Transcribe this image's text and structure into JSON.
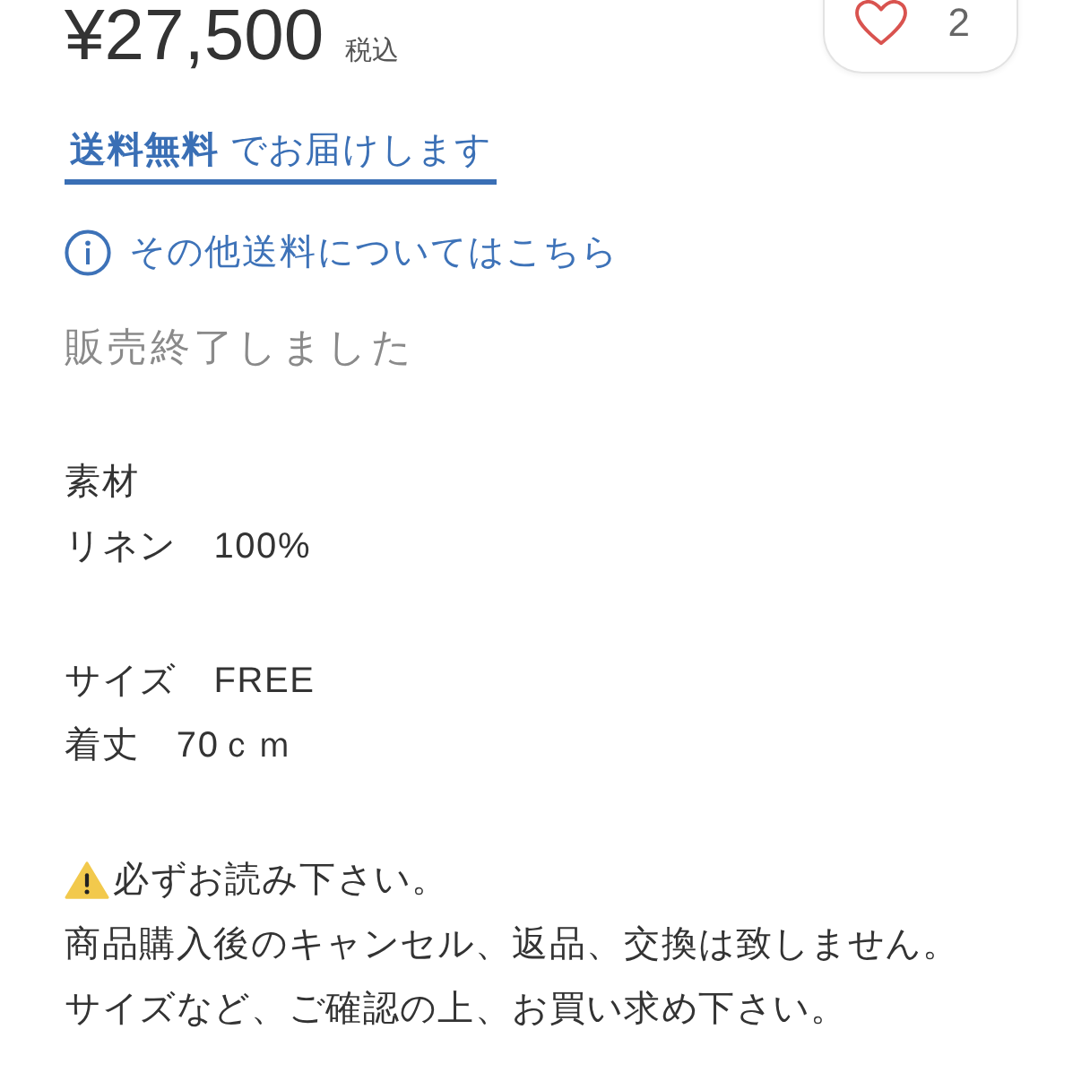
{
  "price": {
    "amount": "¥27,500",
    "tax_note": "税込"
  },
  "like_button": {
    "liked": false,
    "count": "2"
  },
  "shipping_tab": {
    "label": "**送料無料** でお届けします",
    "selected": true
  },
  "shipping_link": {
    "label": "その他送料についてはこちら"
  },
  "status": "販売終了しました",
  "description": [
    {
      "lines": [
        {
          "kind": "plain",
          "text": "素材"
        },
        {
          "kind": "plain",
          "text": "リネン　100%"
        }
      ]
    },
    {
      "lines": [
        {
          "kind": "plain",
          "text": "サイズ　FREE"
        },
        {
          "kind": "plain",
          "text": "着丈　70ｃｍ"
        }
      ]
    },
    {
      "lines": [
        {
          "kind": "warning",
          "text": "必ずお読み下さい。"
        },
        {
          "kind": "plain",
          "text": "商品購入後のキャンセル、返品、交換は致しません。"
        },
        {
          "kind": "plain",
          "text": "サイズなど、ご確認の上、お買い求め下さい。"
        }
      ]
    }
  ]
}
